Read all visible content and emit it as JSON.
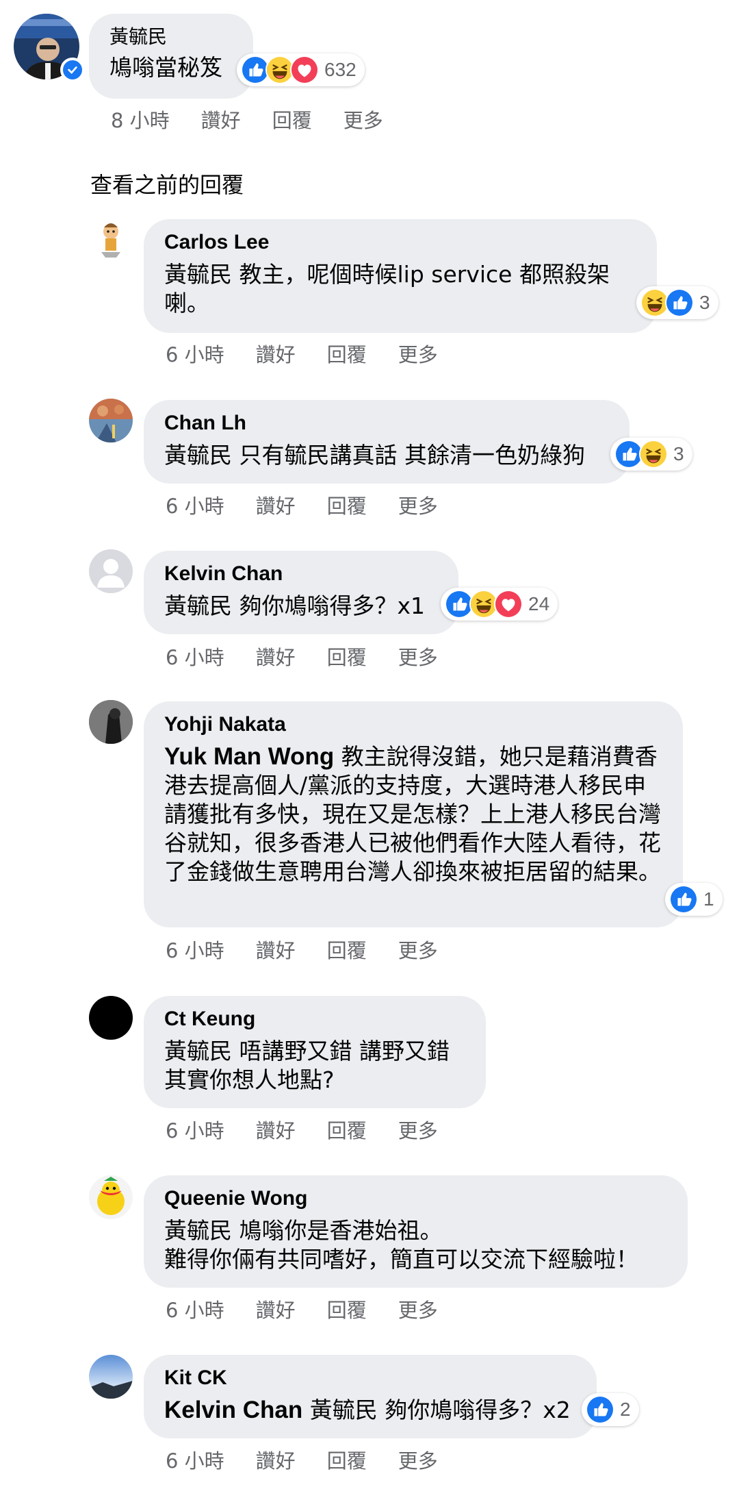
{
  "main_comment": {
    "author": "黃毓民",
    "text": "鳩嗡當秘笈",
    "reaction_count": "632",
    "reactions": [
      "like-icon",
      "haha-icon",
      "love-icon"
    ],
    "time": "8 小時",
    "like": "讚好",
    "reply": "回覆",
    "more": "更多"
  },
  "previous_replies_label": "查看之前的回覆",
  "replies": [
    {
      "author": "Carlos Lee",
      "mention": "",
      "text": "黃毓民 教主，呢個時候lip service 都照殺架喇。",
      "reactions": [
        "haha-icon",
        "like-icon"
      ],
      "reaction_count": "3",
      "time": "6 小時",
      "like": "讚好",
      "reply": "回覆",
      "more": "更多"
    },
    {
      "author": "Chan Lh",
      "mention": "",
      "text": "黃毓民 只有毓民講真話 其餘清一色奶綠狗",
      "reactions": [
        "like-icon",
        "haha-icon"
      ],
      "reaction_count": "3",
      "time": "6 小時",
      "like": "讚好",
      "reply": "回覆",
      "more": "更多"
    },
    {
      "author": "Kelvin Chan",
      "mention": "",
      "text": "黃毓民 夠你鳩嗡得多？x1",
      "reactions": [
        "like-icon",
        "haha-icon",
        "love-icon"
      ],
      "reaction_count": "24",
      "time": "6 小時",
      "like": "讚好",
      "reply": "回覆",
      "more": "更多"
    },
    {
      "author": "Yohji Nakata",
      "mention": "Yuk Man Wong",
      "text": "教主說得沒錯，她只是藉消費香港去提高個人/黨派的支持度，大選時港人移民申請獲批有多快，現在又是怎樣？上上港人移民台灣谷就知，很多香港人已被他們看作大陸人看待，花了金錢做生意聘用台灣人卻換來被拒居留的結果。",
      "reactions": [
        "like-icon"
      ],
      "reaction_count": "1",
      "time": "6 小時",
      "like": "讚好",
      "reply": "回覆",
      "more": "更多"
    },
    {
      "author": "Ct Keung",
      "mention": "",
      "text": "黃毓民 唔講野又錯 講野又錯\n其實你想人地點?",
      "reactions": [],
      "reaction_count": "",
      "time": "6 小時",
      "like": "讚好",
      "reply": "回覆",
      "more": "更多"
    },
    {
      "author": "Queenie Wong",
      "mention": "",
      "text": "黃毓民 鳩嗡你是香港始祖。\n難得你倆有共同嗜好，簡直可以交流下經驗啦！",
      "reactions": [],
      "reaction_count": "",
      "time": "6 小時",
      "like": "讚好",
      "reply": "回覆",
      "more": "更多"
    },
    {
      "author": "Kit CK",
      "mention": "Kelvin Chan",
      "text": "黃毓民 夠你鳩嗡得多？x2",
      "reactions": [
        "like-icon"
      ],
      "reaction_count": "2",
      "time": "6 小時",
      "like": "讚好",
      "reply": "回覆",
      "more": "更多"
    }
  ],
  "colors": {
    "bubble": "#ebedf0",
    "meta_text": "#65676b",
    "like_blue": "#1877f2",
    "love_red": "#f33e58",
    "haha_yellow": "#fcd13f"
  }
}
